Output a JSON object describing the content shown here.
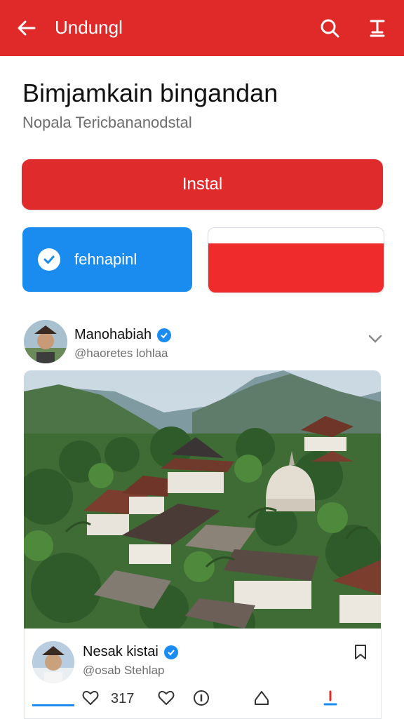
{
  "header": {
    "title": "Undungl",
    "back_icon": "arrow-left-icon",
    "search_icon": "search-icon",
    "download_icon": "download-icon"
  },
  "app": {
    "title": "Bimjamkain bingandan",
    "subtitle": "Nopala Tericbananodstal"
  },
  "buttons": {
    "install": "Instal",
    "secondary": "fehnapinl"
  },
  "post": {
    "author_name": "Manohabiah",
    "author_handle": "@haoretes lohlaa"
  },
  "comment": {
    "author_name": "Nesak kistai",
    "author_handle": "@osab Stehlap",
    "like_count": "317"
  },
  "colors": {
    "brand_red": "#e02a2a",
    "accent_blue": "#1a8cf0"
  }
}
